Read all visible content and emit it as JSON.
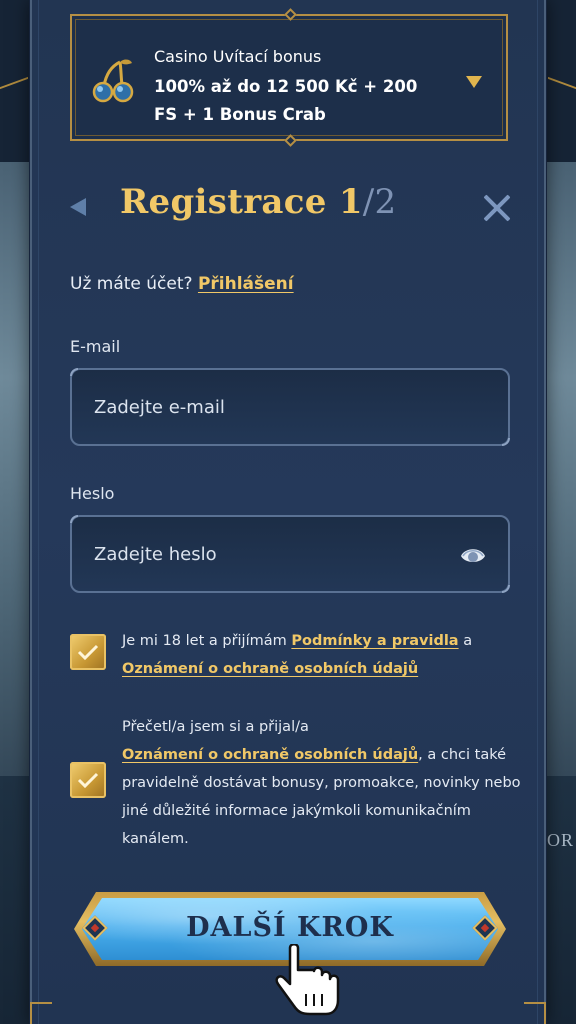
{
  "background": {
    "side_text": "TOR"
  },
  "bonus": {
    "icon": "cherries-icon",
    "title": "Casino Uvítací bonus",
    "main": "100% až do 12 500 Kč + 200 FS + 1 Bonus Crab",
    "expand_icon": "chevron-down-icon"
  },
  "header": {
    "title_prefix": "Registrace 1",
    "title_suffix": "/2",
    "back_icon": "back-arrow-icon",
    "close_icon": "close-icon"
  },
  "account": {
    "question": "Už máte účet?",
    "login_link": "Přihlášení"
  },
  "form": {
    "email": {
      "label": "E-mail",
      "placeholder": "Zadejte e-mail",
      "value": ""
    },
    "password": {
      "label": "Heslo",
      "placeholder": "Zadejte heslo",
      "value": "",
      "toggle_icon": "eye-icon"
    }
  },
  "consents": [
    {
      "checked": true,
      "text_1": "Je mi 18 let a přijímám ",
      "link_1": "Podmínky a pravidla",
      "text_2": " a ",
      "link_2": "Oznámení o ochraně osobních údajů"
    },
    {
      "checked": true,
      "text_1": "Přečetl/a jsem si a přijal/a ",
      "link_1": "Oznámení o ochraně osobních údajů",
      "text_2": ", a chci také pravidelně dostávat bonusy, promoakce, novinky nebo jiné důležité informace jakýmkoli komunikačním kanálem."
    }
  ],
  "cta": {
    "label": "DALŠÍ KROK"
  },
  "colors": {
    "gold": "#f1c867",
    "panel": "#223552",
    "cta_blue": "#4bb0ee"
  }
}
